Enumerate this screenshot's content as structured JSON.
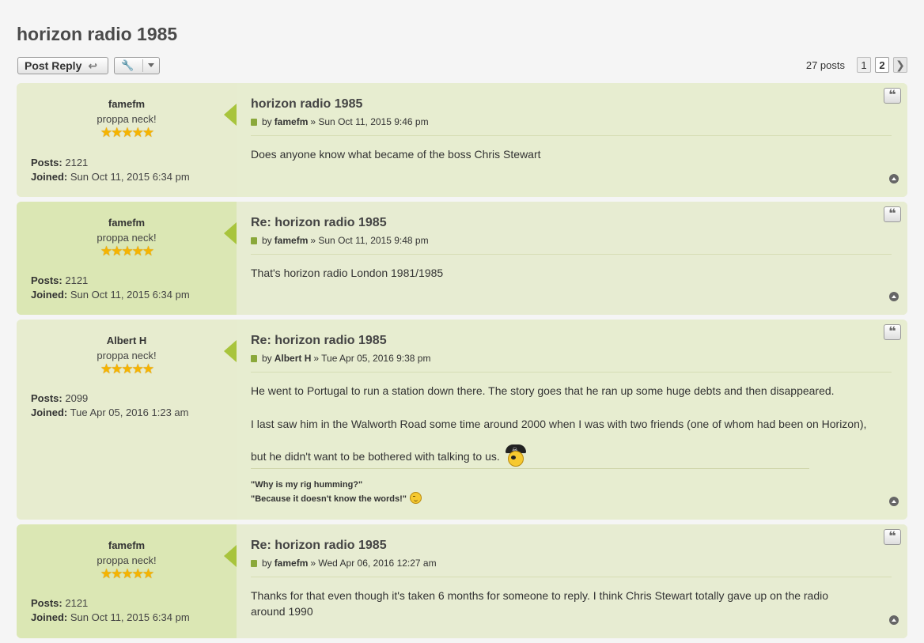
{
  "topic": {
    "title": "horizon radio 1985"
  },
  "actionbar": {
    "post_reply_label": "Post Reply",
    "reply_icon": "reply-arrow-icon",
    "tools_icon": "wrench-icon"
  },
  "pagination": {
    "posts_count": "27 posts",
    "pages": [
      "1",
      "2"
    ],
    "current": "2",
    "next_icon": "chevron-right-icon"
  },
  "posts": [
    {
      "author": "famefm",
      "rank": "proppa neck!",
      "stars": "★★★★★",
      "posts_label": "Posts:",
      "posts_value": "2121",
      "joined_label": "Joined:",
      "joined_value": "Sun Oct 11, 2015 6:34 pm",
      "title": "horizon radio 1985",
      "meta_by": "by",
      "meta_author": "famefm",
      "meta_date": "» Sun Oct 11, 2015 9:46 pm",
      "content": [
        "Does anyone know what became of the boss Chris Stewart"
      ]
    },
    {
      "author": "famefm",
      "rank": "proppa neck!",
      "stars": "★★★★★",
      "posts_label": "Posts:",
      "posts_value": "2121",
      "joined_label": "Joined:",
      "joined_value": "Sun Oct 11, 2015 6:34 pm",
      "title": "Re: horizon radio 1985",
      "meta_by": "by",
      "meta_author": "famefm",
      "meta_date": "» Sun Oct 11, 2015 9:48 pm",
      "content": [
        "That's horizon radio London 1981/1985"
      ]
    },
    {
      "author": "Albert H",
      "rank": "proppa neck!",
      "stars": "★★★★★",
      "posts_label": "Posts:",
      "posts_value": "2099",
      "joined_label": "Joined:",
      "joined_value": "Tue Apr 05, 2016 1:23 am",
      "title": "Re: horizon radio 1985",
      "meta_by": "by",
      "meta_author": "Albert H",
      "meta_date": "» Tue Apr 05, 2016 9:38 pm",
      "content": [
        "He went to Portugal to run a station down there. The story goes that he ran up some huge debts and then disappeared.",
        "I last saw him in the Walworth Road some time around 2000 when I was with two friends (one of whom had been on Horizon),",
        "but he didn't want to be bothered with talking to us."
      ],
      "signature": [
        "\"Why is my rig humming?\"",
        "\"Because it doesn't know the words!\""
      ]
    },
    {
      "author": "famefm",
      "rank": "proppa neck!",
      "stars": "★★★★★",
      "posts_label": "Posts:",
      "posts_value": "2121",
      "joined_label": "Joined:",
      "joined_value": "Sun Oct 11, 2015 6:34 pm",
      "title": "Re: horizon radio 1985",
      "meta_by": "by",
      "meta_author": "famefm",
      "meta_date": "» Wed Apr 06, 2016 12:27 am",
      "content": [
        "Thanks for that even though it's taken 6 months for someone to reply. I think Chris Stewart totally gave up on the radio around 1990"
      ]
    }
  ],
  "icons": {
    "quote": "quote-icon",
    "back_to_top": "arrow-up-circle-icon",
    "post_link": "file-icon",
    "pirate_smiley": "pirate-smiley-icon",
    "wink_smiley": "wink-smiley-icon"
  },
  "colors": {
    "post_bg": "#e7edd0",
    "post_alt_bg": "#e3edb3",
    "arrow": "#a8c43c"
  }
}
